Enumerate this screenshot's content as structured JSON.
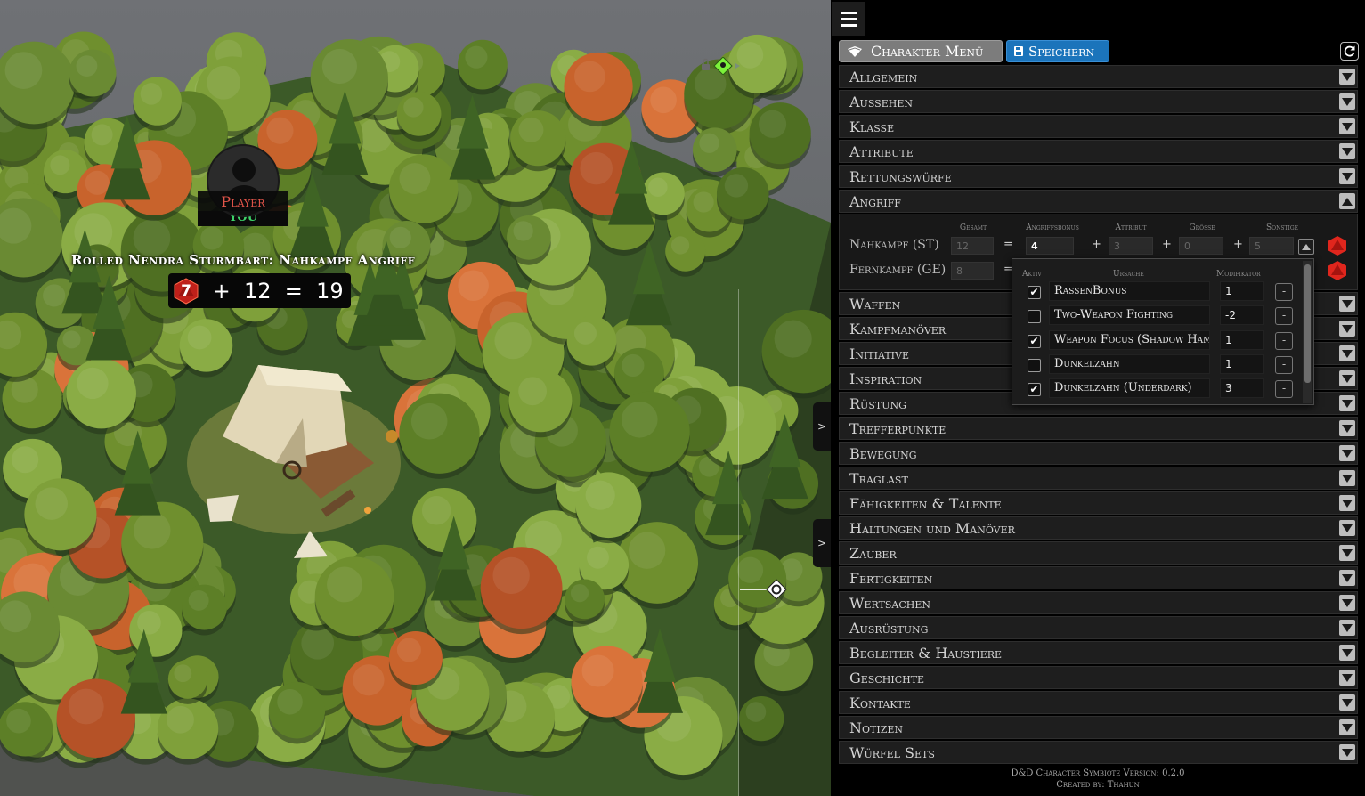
{
  "scene": {
    "player": {
      "name": "Player",
      "tag": "YOU"
    },
    "roll": {
      "title": "Rolled Nendra Sturmbart: Nahkampf Angriff",
      "die_value": "7",
      "expression": " +  12  =  19"
    },
    "edge_tabs": [
      ">",
      ">"
    ]
  },
  "panel": {
    "char_menu_label": "Charakter Menü",
    "save_label": "Speichern",
    "sections_top": [
      {
        "label": "Allgemein"
      },
      {
        "label": "Aussehen"
      },
      {
        "label": "Klasse"
      },
      {
        "label": "Attribute"
      },
      {
        "label": "Rettungswürfe"
      }
    ],
    "angriff": {
      "label": "Angriff",
      "headers": [
        "Gesamt",
        "Angriffsbonus",
        "Attribut",
        "Grösse",
        "Sonstige"
      ],
      "melee": {
        "label": "Nahkampf (ST)",
        "total": "12",
        "attack_bonus": "4",
        "attribute": "3",
        "size": "0",
        "other": "5"
      },
      "ranged": {
        "label": "Fernkampf (GE)",
        "total": "8"
      },
      "ops": {
        "eq": "=",
        "plus": "+"
      }
    },
    "modifier_popup": {
      "headers": {
        "active": "Aktiv",
        "cause": "Ursache",
        "modifier": "Modifikator"
      },
      "rows": [
        {
          "checked": "✔",
          "cause": "RassenBonus",
          "modifier": "1",
          "remove": "-"
        },
        {
          "checked": "",
          "cause": "Two-Weapon Fighting",
          "modifier": "-2",
          "remove": "-"
        },
        {
          "checked": "✔",
          "cause": "Weapon Focus (Shadow Hammer)",
          "modifier": "1",
          "remove": "-"
        },
        {
          "checked": "",
          "cause": "Dunkelzahn",
          "modifier": "1",
          "remove": "-"
        },
        {
          "checked": "✔",
          "cause": "Dunkelzahn (Underdark)",
          "modifier": "3",
          "remove": "-"
        }
      ]
    },
    "sections_bottom": [
      {
        "label": "Waffen"
      },
      {
        "label": "Kampfmanöver"
      },
      {
        "label": "Initiative"
      },
      {
        "label": "Inspiration"
      },
      {
        "label": "Rüstung"
      },
      {
        "label": "Trefferpunkte"
      },
      {
        "label": "Bewegung"
      },
      {
        "label": "Traglast"
      },
      {
        "label": "Fähigkeiten & Talente"
      },
      {
        "label": "Haltungen und Manöver"
      },
      {
        "label": "Zauber"
      },
      {
        "label": "Fertigkeiten"
      },
      {
        "label": "Wertsachen"
      },
      {
        "label": "Ausrüstung"
      },
      {
        "label": "Begleiter & Haustiere"
      },
      {
        "label": "Geschichte"
      },
      {
        "label": "Kontakte"
      },
      {
        "label": "Notizen"
      },
      {
        "label": "Würfel Sets"
      }
    ],
    "footer": {
      "line1": "D&D Character Symbiote  Version: 0.2.0",
      "line2": "Created by: Thahun"
    }
  }
}
